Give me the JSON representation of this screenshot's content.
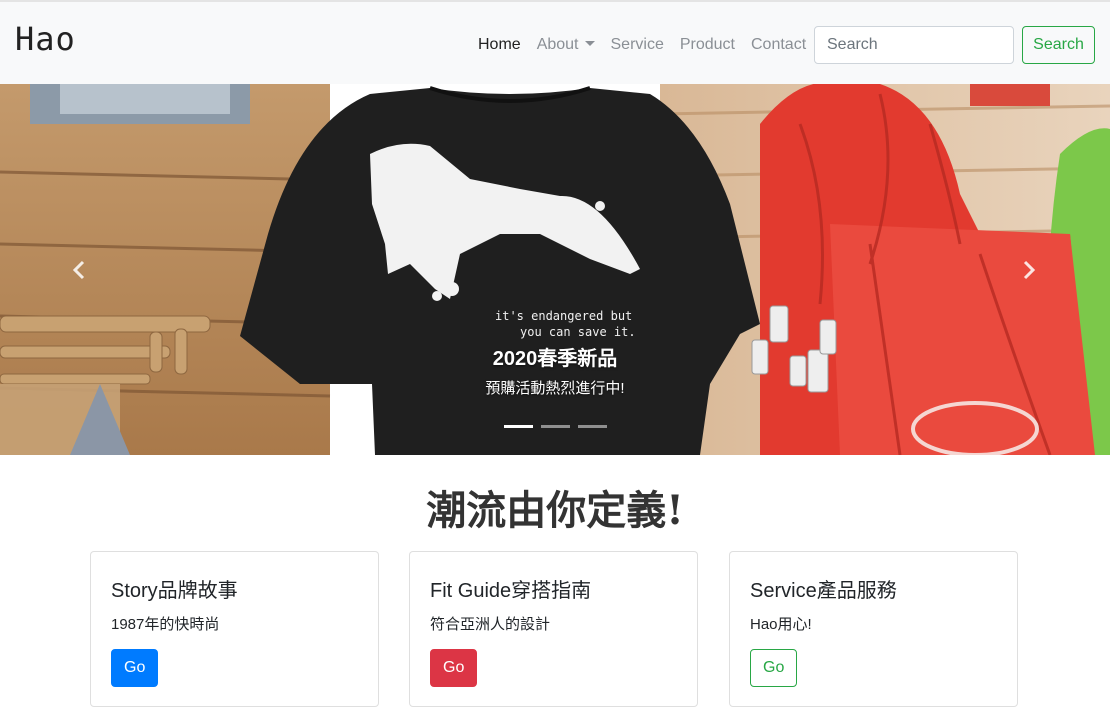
{
  "brand": "Hao",
  "nav": {
    "items": [
      {
        "label": "Home",
        "active": true
      },
      {
        "label": "About",
        "dropdown": true
      },
      {
        "label": "Service"
      },
      {
        "label": "Product"
      },
      {
        "label": "Contact"
      }
    ],
    "search_placeholder": "Search",
    "search_button": "Search"
  },
  "carousel": {
    "image": "black T-shirt with white animal print and red tote bags in a shop",
    "shirt_print_text": [
      "it's endangered but",
      "you can save it."
    ],
    "caption_title": "2020春季新品",
    "caption_text": "預購活動熱烈進行中!",
    "indicators": 3,
    "active_index": 0,
    "prev_icon": "chevron-left-icon",
    "next_icon": "chevron-right-icon"
  },
  "headline": "潮流由你定義!",
  "cards": [
    {
      "title": "Story品牌故事",
      "text": "1987年的快時尚",
      "button": "Go",
      "button_style": "primary"
    },
    {
      "title": "Fit Guide穿搭指南",
      "text": "符合亞洲人的設計",
      "button": "Go",
      "button_style": "danger"
    },
    {
      "title": "Service產品服務",
      "text": "Hao用心!",
      "button": "Go",
      "button_style": "outline-success"
    }
  ],
  "colors": {
    "navbar_bg": "#f8f9fa",
    "primary": "#007bff",
    "danger": "#dc3545",
    "success": "#28a745"
  }
}
